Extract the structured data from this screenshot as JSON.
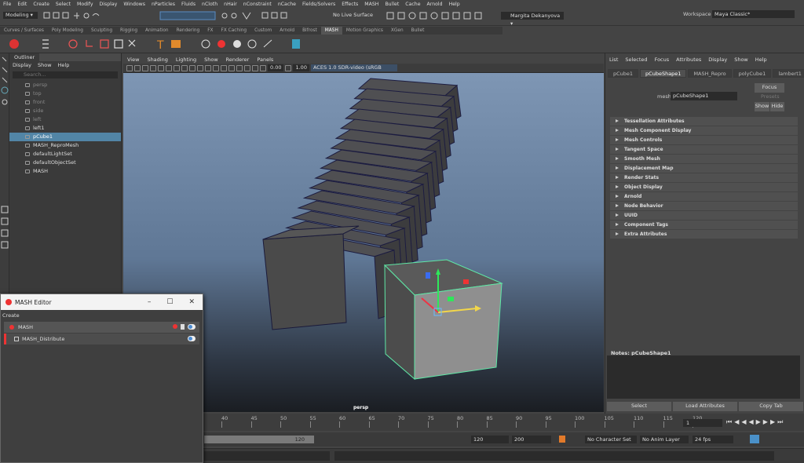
{
  "menubar": [
    "File",
    "Edit",
    "Create",
    "Select",
    "Modify",
    "Display",
    "Windows",
    "nParticles",
    "Fluids",
    "nCloth",
    "nHair",
    "nConstraint",
    "nCache",
    "Fields/Solvers",
    "Effects",
    "MASH",
    "Bullet",
    "Cache",
    "Arnold",
    "Help"
  ],
  "toolbar": {
    "mode": "Modeling",
    "live_surface": "No Live Surface",
    "user": "Margita Dekanyova",
    "workspace_label": "Workspace :",
    "workspace": "Maya Classic*"
  },
  "shelf_tabs": [
    "Curves / Surfaces",
    "Poly Modeling",
    "Sculpting",
    "Rigging",
    "Animation",
    "Rendering",
    "FX",
    "FX Caching",
    "Custom",
    "Arnold",
    "Bifrost",
    "MASH",
    "Motion Graphics",
    "XGen",
    "Bullet"
  ],
  "active_shelf_tab": "MASH",
  "outliner": {
    "title": "Outliner",
    "menu": [
      "Display",
      "Show",
      "Help"
    ],
    "search_placeholder": "Search...",
    "items": [
      {
        "label": "persp"
      },
      {
        "label": "top"
      },
      {
        "label": "front"
      },
      {
        "label": "side"
      },
      {
        "label": "left"
      },
      {
        "label": "left1"
      },
      {
        "label": "pCube1"
      },
      {
        "label": "MASH_ReproMesh"
      },
      {
        "label": "defaultLightSet"
      },
      {
        "label": "defaultObjectSet"
      },
      {
        "label": "MASH"
      }
    ]
  },
  "viewport": {
    "menu": [
      "View",
      "Shading",
      "Lighting",
      "Show",
      "Renderer",
      "Panels"
    ],
    "near": "0.00",
    "far": "1.00",
    "colorspace": "ACES 1.0 SDR-video (sRGB",
    "camera_label": "persp"
  },
  "attr": {
    "menu": [
      "List",
      "Selected",
      "Focus",
      "Attributes",
      "Display",
      "Show",
      "Help"
    ],
    "node_tabs": [
      "pCube1",
      "pCubeShape1",
      "MASH_Repro",
      "polyCube1",
      "lambert1"
    ],
    "active_tab": "pCubeShape1",
    "mesh_label": "mesh:",
    "mesh_value": "pCubeShape1",
    "focus": "Focus",
    "presets": "Presets",
    "show": "Show",
    "hide": "Hide",
    "sections": [
      "Tessellation Attributes",
      "Mesh Component Display",
      "Mesh Controls",
      "Tangent Space",
      "Smooth Mesh",
      "Displacement Map",
      "Render Stats",
      "Object Display",
      "Arnold",
      "Node Behavior",
      "UUID",
      "Component Tags",
      "Extra Attributes"
    ],
    "notes_label": "Notes:  pCubeShape1",
    "buttons": [
      "Select",
      "Load Attributes",
      "Copy Tab"
    ]
  },
  "timeline": {
    "ticks": [
      "40",
      "45",
      "50",
      "55",
      "60",
      "65",
      "70",
      "75",
      "80",
      "85",
      "90",
      "95",
      "100",
      "105",
      "110",
      "115",
      "120"
    ],
    "current_frame": "1"
  },
  "range": {
    "end_inner": "120",
    "end_outer": "120",
    "max": "200",
    "char_set": "No Character Set",
    "anim_layer": "No Anim Layer",
    "fps": "24 fps"
  },
  "mash_editor": {
    "title": "MASH Editor",
    "create": "Create",
    "network": "MASH",
    "node": "MASH_Distribute"
  }
}
